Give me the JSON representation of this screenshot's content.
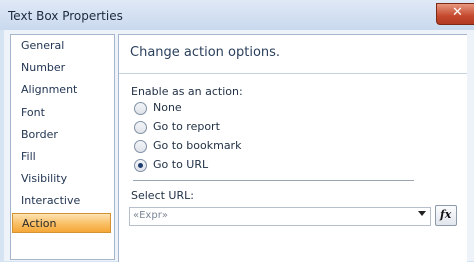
{
  "window": {
    "title": "Text Box Properties",
    "close_glyph": "✕"
  },
  "nav": {
    "items": [
      {
        "label": "General"
      },
      {
        "label": "Number"
      },
      {
        "label": "Alignment"
      },
      {
        "label": "Font"
      },
      {
        "label": "Border"
      },
      {
        "label": "Fill"
      },
      {
        "label": "Visibility"
      },
      {
        "label": "Interactive Sorting"
      },
      {
        "label": "Action",
        "selected": true
      }
    ]
  },
  "panel": {
    "heading": "Change action options.",
    "enable_label": "Enable as an action:",
    "options": [
      {
        "label": "None",
        "checked": false
      },
      {
        "label": "Go to report",
        "checked": false
      },
      {
        "label": "Go to bookmark",
        "checked": false
      },
      {
        "label": "Go to URL",
        "checked": true
      }
    ],
    "select_url_label": "Select URL:",
    "url_value": "«Expr»",
    "expr_button_label": "fx"
  },
  "colors": {
    "selected_nav": "#f9be63",
    "accent": "#1e3e6f",
    "close_button": "#c4492e"
  }
}
